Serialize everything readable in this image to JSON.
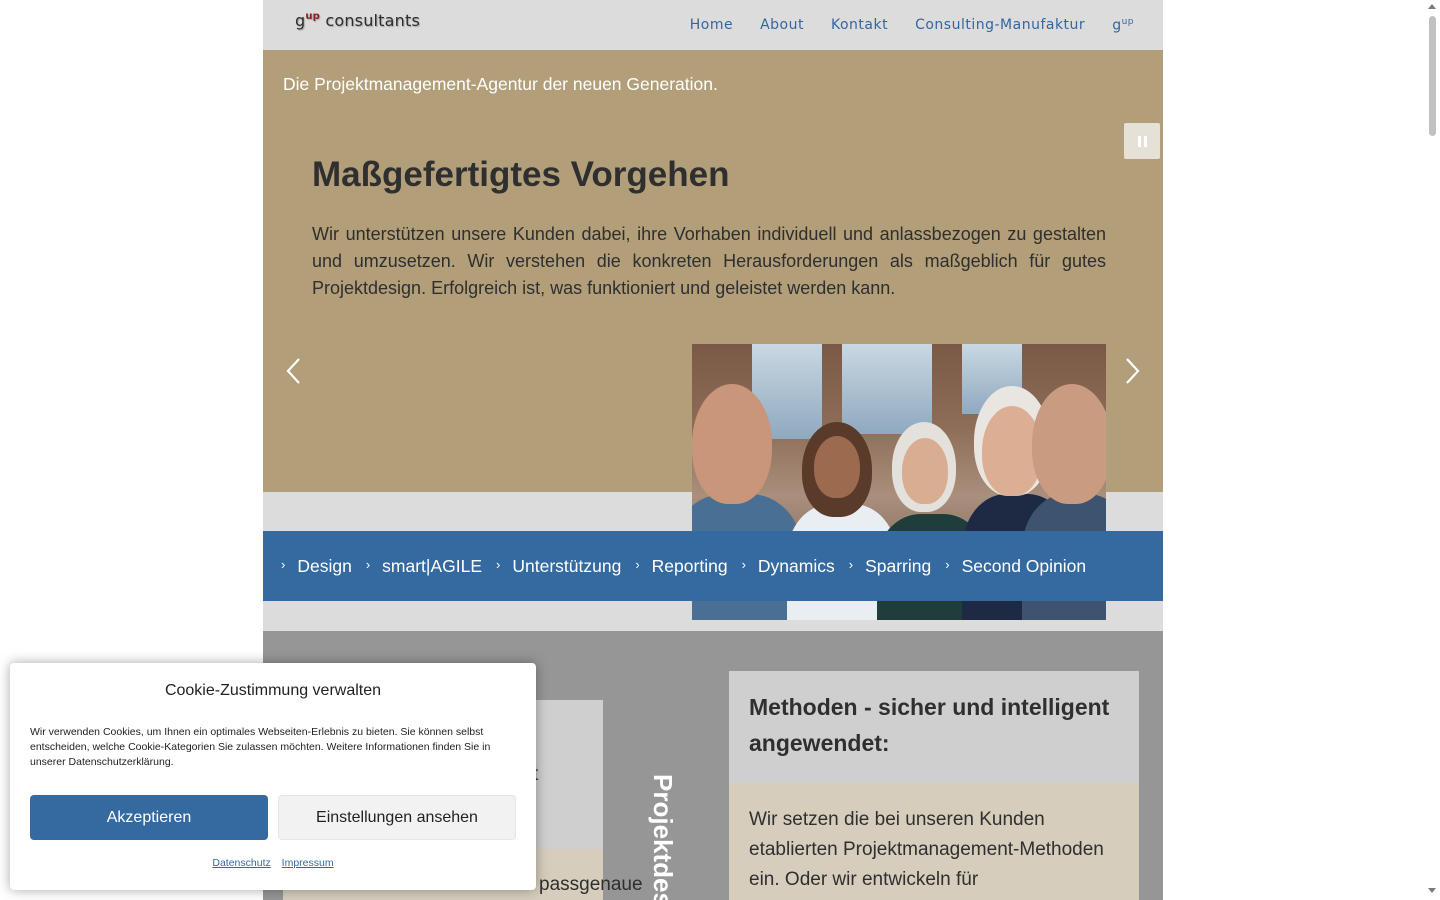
{
  "header": {
    "logo_base": "g",
    "logo_sup": "up",
    "logo_rest": " consultants",
    "nav": [
      {
        "label": "Home"
      },
      {
        "label": "About"
      },
      {
        "label": "Kontakt"
      },
      {
        "label": "Consulting-Manufaktur"
      },
      {
        "label": "g",
        "sup": "up"
      }
    ]
  },
  "hero": {
    "tagline": "Die Projektmanagement-Agentur der neuen Generation.",
    "slide_title": "Maßgefertigtes Vorgehen",
    "slide_text": "Wir unterstützen unsere Kunden dabei, ihre Vorhaben individuell und anlassbezogen zu gestalten und umzusetzen. Wir verstehen die konkreten Herausforderungen als maßgeblich für gutes Projektdesign. Erfolgreich ist, was funktioniert und geleistet werden kann.",
    "colors": {
      "background": "#b29e78",
      "text": "#2f2f2f"
    }
  },
  "services": [
    {
      "label": "Design"
    },
    {
      "label": "smart|AGILE"
    },
    {
      "label": "Unterstützung"
    },
    {
      "label": "Reporting"
    },
    {
      "label": "Dynamics"
    },
    {
      "label": "Sparring"
    },
    {
      "label": "Second Opinion"
    }
  ],
  "content": {
    "left_card_peek": "t",
    "left_card_bottom": "passgenaue",
    "vertical_label": "Projektdes",
    "right_card": {
      "title": "Methoden - sicher und intelligent angewendet:",
      "body": "Wir setzen die bei unseren Kunden etablierten Projektmanagement-Methoden ein. Oder wir entwickeln für"
    }
  },
  "cookie": {
    "title": "Cookie-Zustimmung verwalten",
    "text": "Wir verwenden Cookies, um Ihnen ein optimales Webseiten-Erlebnis zu bieten. Sie können selbst entscheiden, welche Cookie-Kategorien Sie zulassen möchten. Weitere Informationen finden Sie in unserer Datenschutzerklärung.",
    "accept_label": "Akzeptieren",
    "settings_label": "Einstellungen ansehen",
    "links": [
      {
        "label": "Datenschutz"
      },
      {
        "label": "Impressum"
      }
    ]
  },
  "colors": {
    "brand_blue": "#356aa0",
    "header_gray": "#dcdcdc",
    "hero_tan": "#b29e78",
    "logo_red": "#8b1e1e"
  }
}
